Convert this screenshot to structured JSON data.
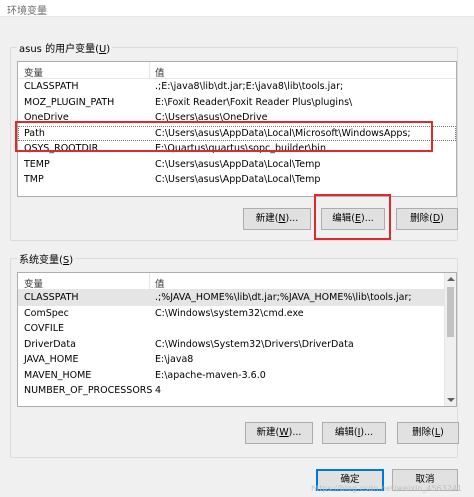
{
  "window": {
    "title": "环境变量"
  },
  "user_vars": {
    "group_label": "asus 的用户变量(",
    "group_label_accel": "U",
    "group_label_end": ")",
    "columns": [
      "变量",
      "值"
    ],
    "rows": [
      {
        "name": "CLASSPATH",
        "value": ".;E:\\java8\\lib\\dt.jar;E:\\java8\\lib\\tools.jar;"
      },
      {
        "name": "MOZ_PLUGIN_PATH",
        "value": "E:\\Foxit Reader\\Foxit Reader Plus\\plugins\\"
      },
      {
        "name": "OneDrive",
        "value": "C:\\Users\\asus\\OneDrive"
      },
      {
        "name": "Path",
        "value": "C:\\Users\\asus\\AppData\\Local\\Microsoft\\WindowsApps;"
      },
      {
        "name": "QSYS_ROOTDIR",
        "value": "E:\\Quartus\\quartus\\sopc_builder\\bin"
      },
      {
        "name": "TEMP",
        "value": "C:\\Users\\asus\\AppData\\Local\\Temp"
      },
      {
        "name": "TMP",
        "value": "C:\\Users\\asus\\AppData\\Local\\Temp"
      }
    ],
    "buttons": {
      "new": {
        "label": "新建(",
        "accel": "N",
        "end": ")..."
      },
      "edit": {
        "label": "编辑(",
        "accel": "E",
        "end": ")..."
      },
      "delete": {
        "label": "删除(",
        "accel": "D",
        "end": ")"
      }
    }
  },
  "system_vars": {
    "group_label": "系统变量(",
    "group_label_accel": "S",
    "group_label_end": ")",
    "columns": [
      "变量",
      "值"
    ],
    "rows": [
      {
        "name": "CLASSPATH",
        "value": ".;%JAVA_HOME%\\lib\\dt.jar;%JAVA_HOME%\\lib\\tools.jar;"
      },
      {
        "name": "ComSpec",
        "value": "C:\\Windows\\system32\\cmd.exe"
      },
      {
        "name": "COVFILE",
        "value": ""
      },
      {
        "name": "DriverData",
        "value": "C:\\Windows\\System32\\Drivers\\DriverData"
      },
      {
        "name": "JAVA_HOME",
        "value": "E:\\java8"
      },
      {
        "name": "MAVEN_HOME",
        "value": "E:\\apache-maven-3.6.0"
      },
      {
        "name": "NUMBER_OF_PROCESSORS",
        "value": "4"
      }
    ],
    "buttons": {
      "new": {
        "label": "新建(",
        "accel": "W",
        "end": ")..."
      },
      "edit": {
        "label": "编辑(",
        "accel": "I",
        "end": ")..."
      },
      "delete": {
        "label": "删除(",
        "accel": "L",
        "end": ")"
      }
    }
  },
  "footer": {
    "ok": "确定",
    "cancel": "取消"
  },
  "watermark": "https://blog.csdn.net/weixin_4563241",
  "colors": {
    "highlight": "#e0292f",
    "default_button_border": "#0078d7"
  }
}
